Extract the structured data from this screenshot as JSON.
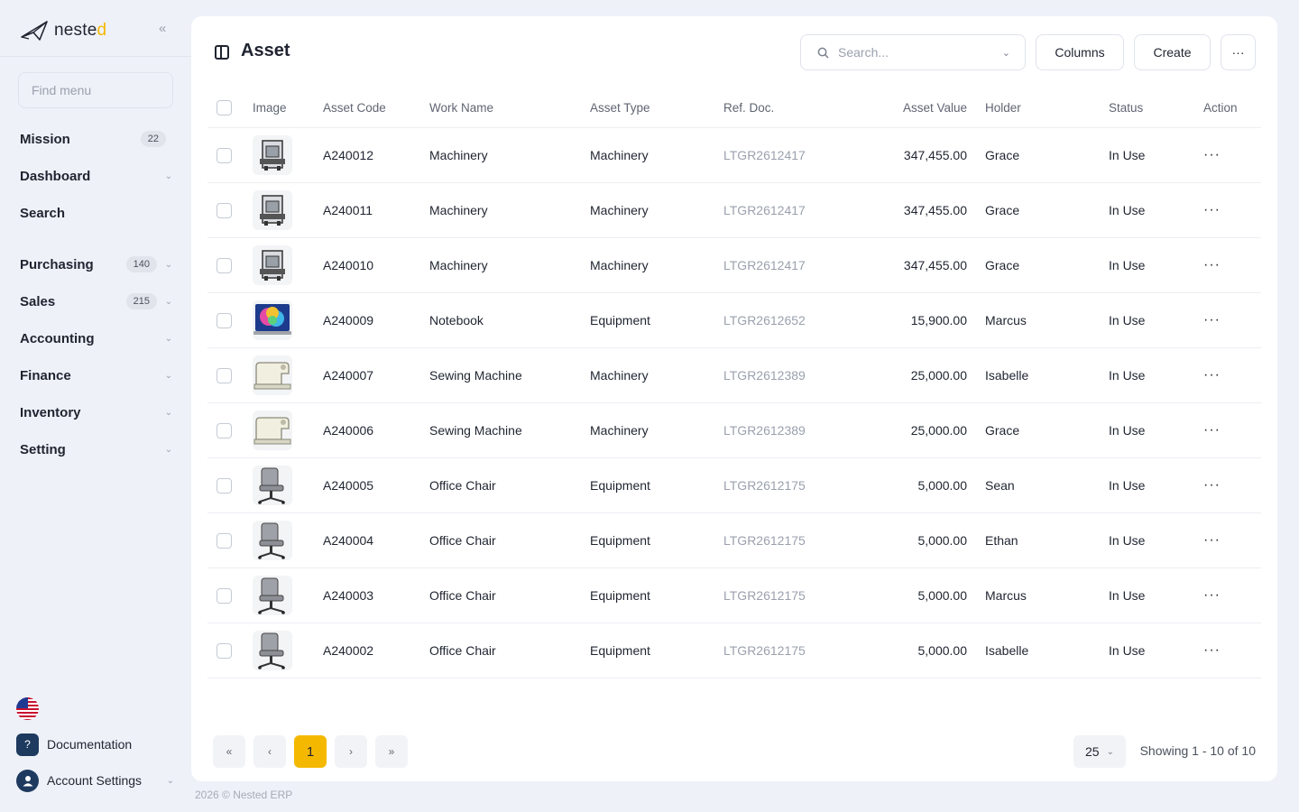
{
  "brand": {
    "name_main": "neste",
    "name_accent": "d"
  },
  "sidebar": {
    "collapse_icon": "double-chevron-left-icon",
    "find_menu_placeholder": "Find menu",
    "items": [
      {
        "label": "Mission",
        "badge": "22",
        "has_chevron": false
      },
      {
        "label": "Dashboard",
        "badge": "",
        "has_chevron": true
      },
      {
        "label": "Search",
        "badge": "",
        "has_chevron": false
      },
      {
        "label": "Purchasing",
        "badge": "140",
        "has_chevron": true
      },
      {
        "label": "Sales",
        "badge": "215",
        "has_chevron": true
      },
      {
        "label": "Accounting",
        "badge": "",
        "has_chevron": true
      },
      {
        "label": "Finance",
        "badge": "",
        "has_chevron": true
      },
      {
        "label": "Inventory",
        "badge": "",
        "has_chevron": true
      },
      {
        "label": "Setting",
        "badge": "",
        "has_chevron": true
      }
    ],
    "documentation_label": "Documentation",
    "account_settings_label": "Account Settings"
  },
  "footer": "2026 © Nested ERP",
  "page": {
    "title": "Asset",
    "search_placeholder": "Search...",
    "columns_label": "Columns",
    "create_label": "Create",
    "more_label": "···"
  },
  "table": {
    "headers": {
      "image": "Image",
      "asset_code": "Asset Code",
      "work_name": "Work Name",
      "asset_type": "Asset Type",
      "ref_doc": "Ref. Doc.",
      "asset_value": "Asset Value",
      "holder": "Holder",
      "status": "Status",
      "action": "Action"
    },
    "rows": [
      {
        "image": "machinery",
        "asset_code": "A240012",
        "work_name": "Machinery",
        "asset_type": "Machinery",
        "ref_doc": "LTGR2612417",
        "asset_value": "347,455.00",
        "holder": "Grace",
        "status": "In Use"
      },
      {
        "image": "machinery",
        "asset_code": "A240011",
        "work_name": "Machinery",
        "asset_type": "Machinery",
        "ref_doc": "LTGR2612417",
        "asset_value": "347,455.00",
        "holder": "Grace",
        "status": "In Use"
      },
      {
        "image": "machinery",
        "asset_code": "A240010",
        "work_name": "Machinery",
        "asset_type": "Machinery",
        "ref_doc": "LTGR2612417",
        "asset_value": "347,455.00",
        "holder": "Grace",
        "status": "In Use"
      },
      {
        "image": "notebook",
        "asset_code": "A240009",
        "work_name": "Notebook",
        "asset_type": "Equipment",
        "ref_doc": "LTGR2612652",
        "asset_value": "15,900.00",
        "holder": "Marcus",
        "status": "In Use"
      },
      {
        "image": "sewing",
        "asset_code": "A240007",
        "work_name": "Sewing Machine",
        "asset_type": "Machinery",
        "ref_doc": "LTGR2612389",
        "asset_value": "25,000.00",
        "holder": "Isabelle",
        "status": "In Use"
      },
      {
        "image": "sewing",
        "asset_code": "A240006",
        "work_name": "Sewing Machine",
        "asset_type": "Machinery",
        "ref_doc": "LTGR2612389",
        "asset_value": "25,000.00",
        "holder": "Grace",
        "status": "In Use"
      },
      {
        "image": "chair",
        "asset_code": "A240005",
        "work_name": "Office Chair",
        "asset_type": "Equipment",
        "ref_doc": "LTGR2612175",
        "asset_value": "5,000.00",
        "holder": "Sean",
        "status": "In Use"
      },
      {
        "image": "chair",
        "asset_code": "A240004",
        "work_name": "Office Chair",
        "asset_type": "Equipment",
        "ref_doc": "LTGR2612175",
        "asset_value": "5,000.00",
        "holder": "Ethan",
        "status": "In Use"
      },
      {
        "image": "chair",
        "asset_code": "A240003",
        "work_name": "Office Chair",
        "asset_type": "Equipment",
        "ref_doc": "LTGR2612175",
        "asset_value": "5,000.00",
        "holder": "Marcus",
        "status": "In Use"
      },
      {
        "image": "chair",
        "asset_code": "A240002",
        "work_name": "Office Chair",
        "asset_type": "Equipment",
        "ref_doc": "LTGR2612175",
        "asset_value": "5,000.00",
        "holder": "Isabelle",
        "status": "In Use"
      }
    ]
  },
  "pagination": {
    "first": "«",
    "prev": "‹",
    "current": "1",
    "next": "›",
    "last": "»",
    "per_page": "25",
    "showing": "Showing 1 - 10 of 10"
  },
  "colors": {
    "accent": "#f5b800",
    "background": "#eef1f8",
    "ref_text": "#9aa0ad",
    "icon_navy": "#1e3a5f"
  }
}
